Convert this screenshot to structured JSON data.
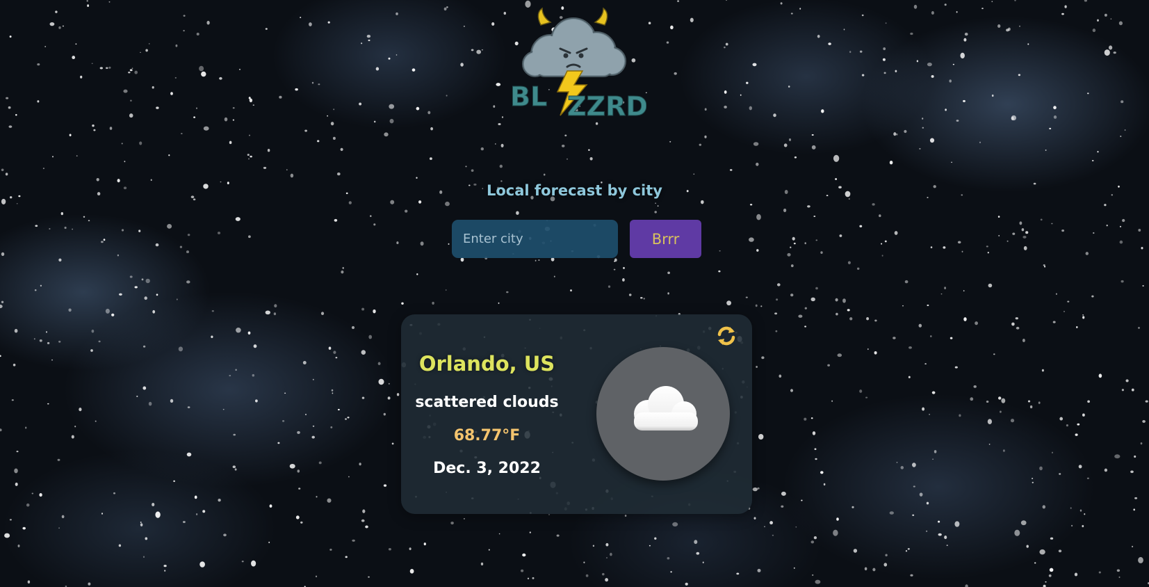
{
  "app": {
    "logo_text": "BLIZZRD"
  },
  "header": {
    "tagline": "Local forecast by city"
  },
  "search": {
    "placeholder": "Enter city",
    "value": "",
    "button_label": "Brrr"
  },
  "weather": {
    "city": "Orlando, US",
    "description": "scattered clouds",
    "temperature": "68.77°F",
    "date": "Dec. 3, 2022",
    "condition_icon": "cloud-icon",
    "refresh_icon": "refresh-icon"
  },
  "colors": {
    "tagline": "#8ec7db",
    "input_bg": "#1e4e6c",
    "button_bg": "#5f3aa4",
    "button_text": "#d8c25e",
    "city": "#dde45e",
    "temperature": "#f4c46e",
    "card_bg": "#202c36",
    "logo_teal": "#3f8a8c",
    "logo_yellow": "#f2c81c"
  }
}
